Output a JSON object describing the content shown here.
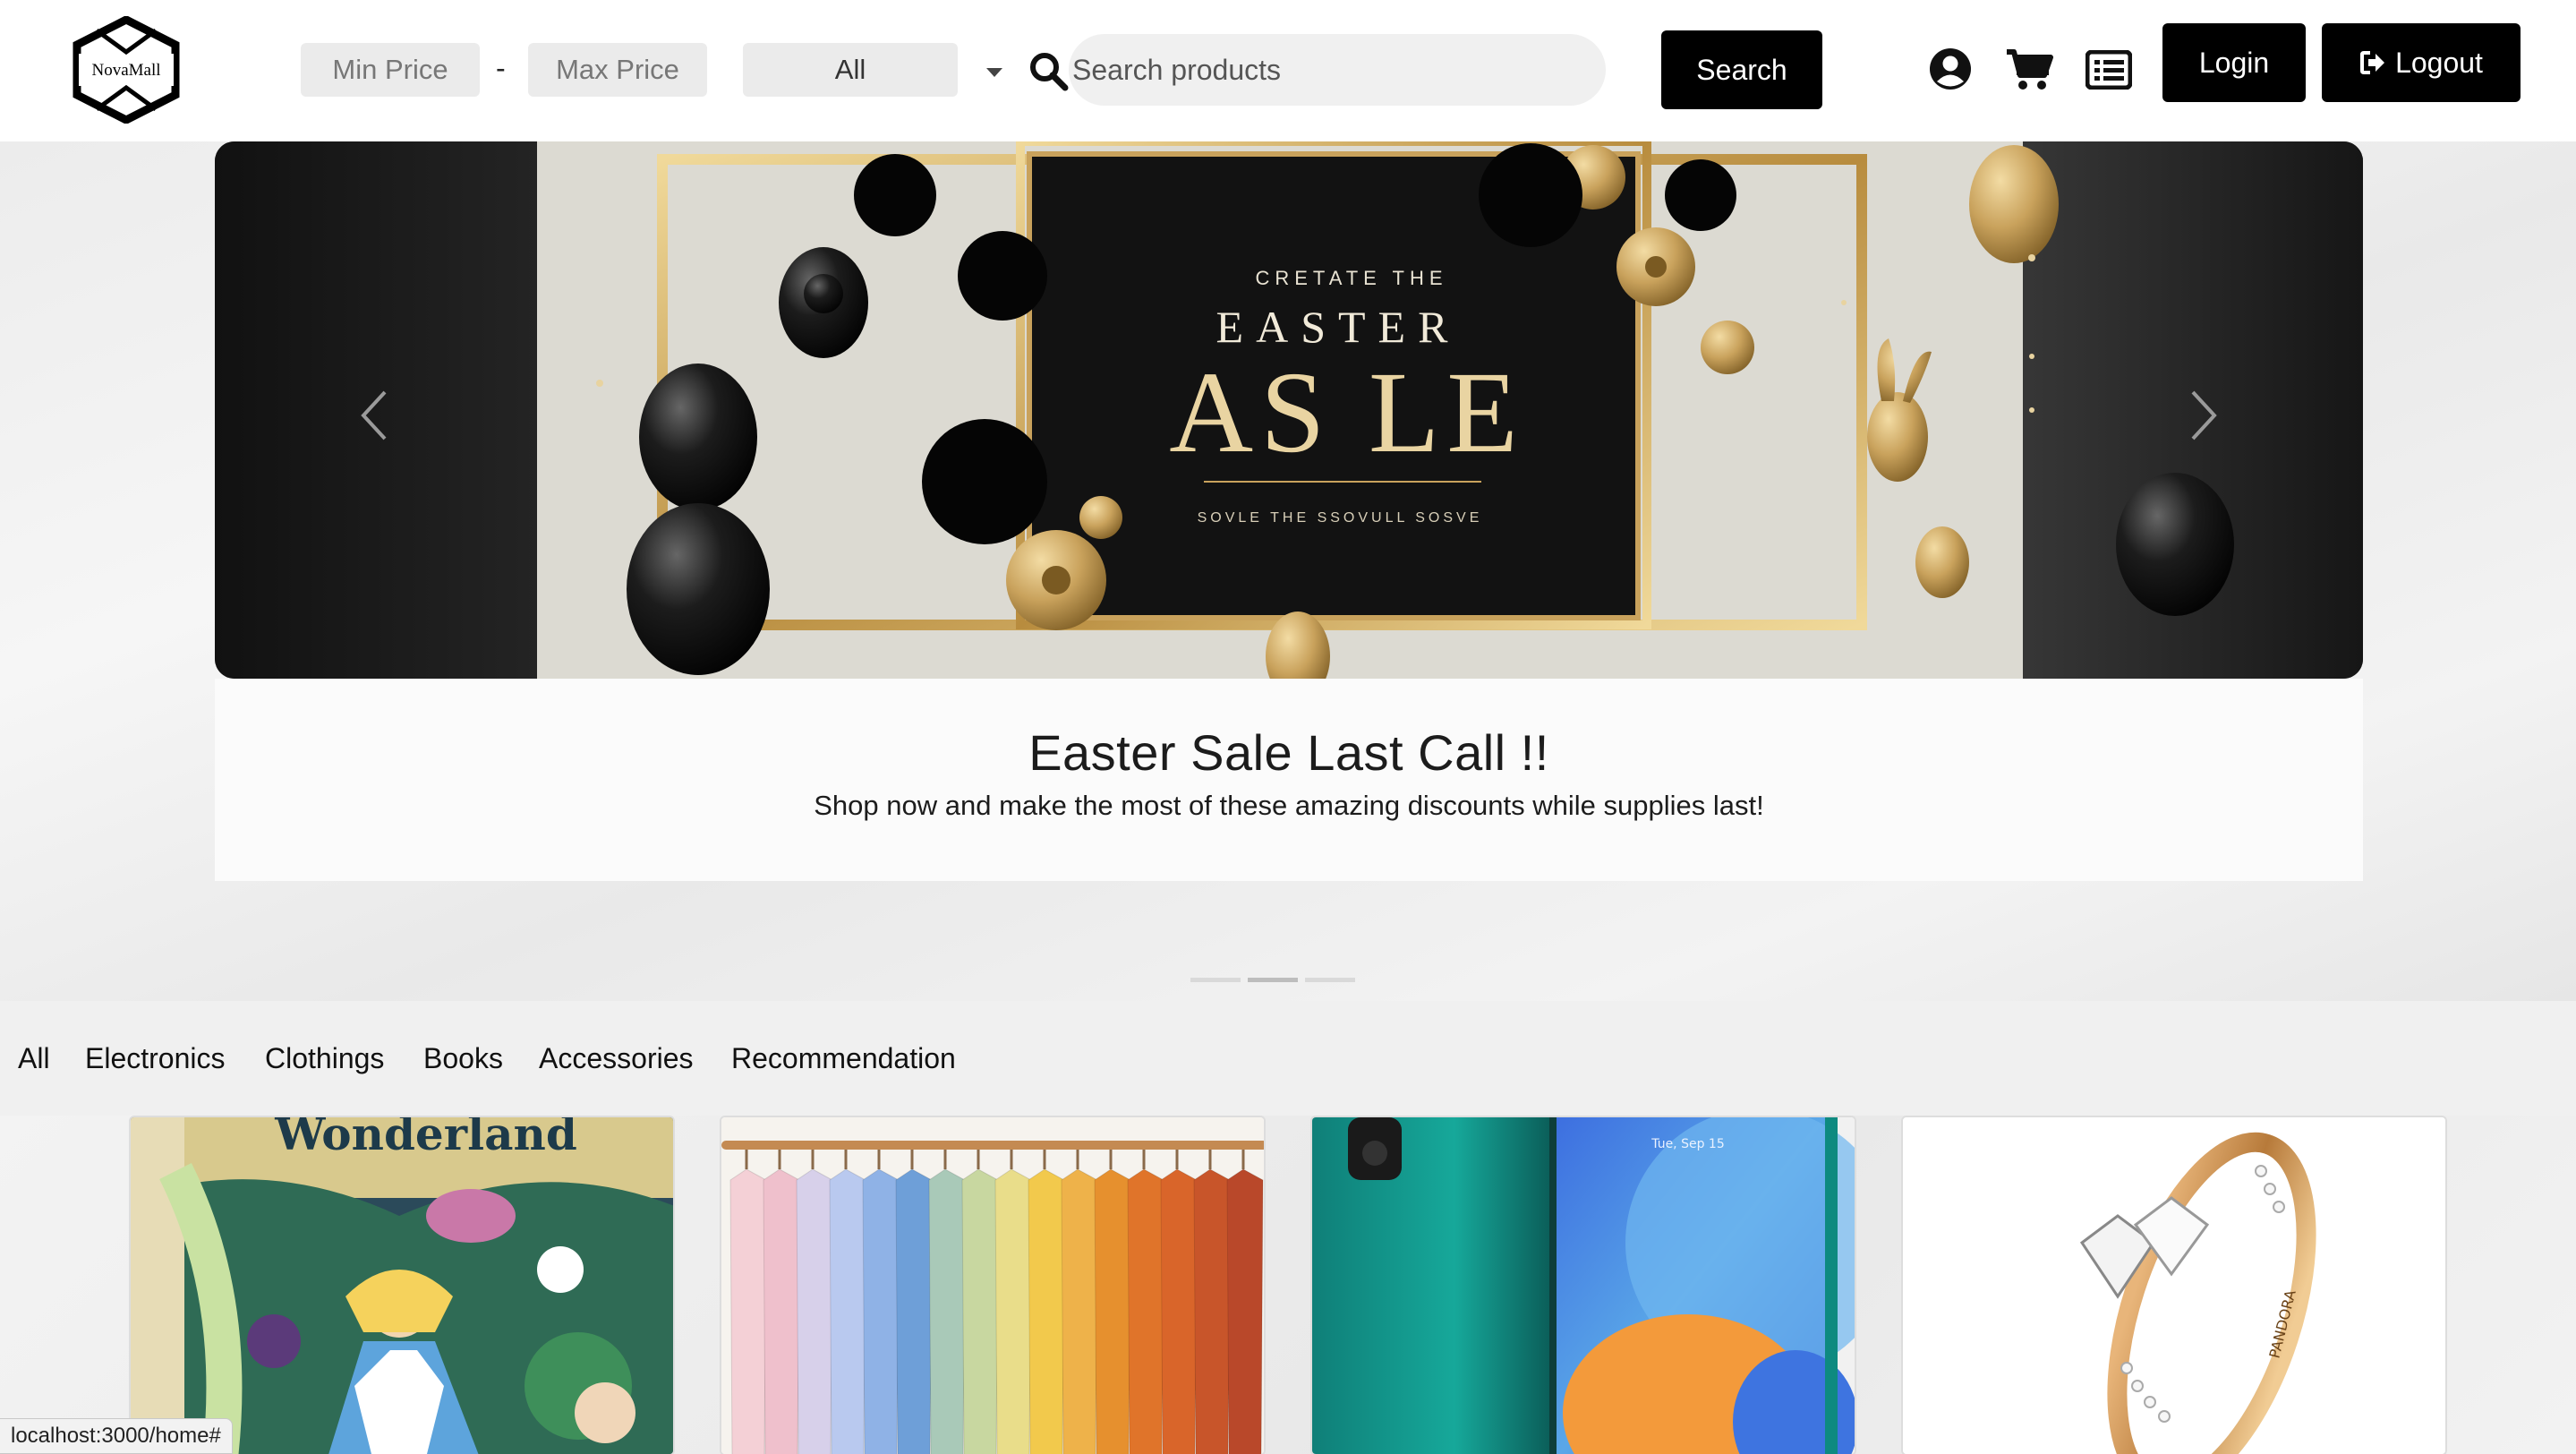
{
  "header": {
    "logo_text": "NovaMall",
    "min_price_placeholder": "Min Price",
    "max_price_placeholder": "Max Price",
    "separator": "-",
    "category_select": "All",
    "search_placeholder": "Search products",
    "search_button": "Search",
    "login_button": "Login",
    "logout_button": "Logout",
    "icons": [
      "user-circle-icon",
      "shopping-cart-icon",
      "order-list-icon"
    ]
  },
  "hero": {
    "banner_text": {
      "line1": "CRETATE THE",
      "line2": "EASTER",
      "line3": "AS LE",
      "line4": "SOVLE THE SSOVULL SOSVE"
    },
    "caption_title": "Easter Sale Last Call !!",
    "caption_text": "Shop now and make the most of these amazing discounts while supplies last!",
    "slides_count": 3,
    "active_slide": 2
  },
  "tabs": [
    "All",
    "Electronics",
    "Clothings",
    "Books",
    "Accessories",
    "Recommendation"
  ],
  "products": [
    {
      "image": "alice-in-wonderland-book-cover",
      "image_text": "Wonderland"
    },
    {
      "image": "clothing-rack-colorful-shirts"
    },
    {
      "image": "green-smartphone",
      "image_text": "Tue, Sep 15"
    },
    {
      "image": "gold-heart-diamond-ring",
      "image_text": "PANDORA"
    }
  ],
  "status_bar": "localhost:3000/home#",
  "colors": {
    "primary_button": "#000000",
    "page_bg": "#efefef",
    "banner_gold": "#c9a25c"
  }
}
